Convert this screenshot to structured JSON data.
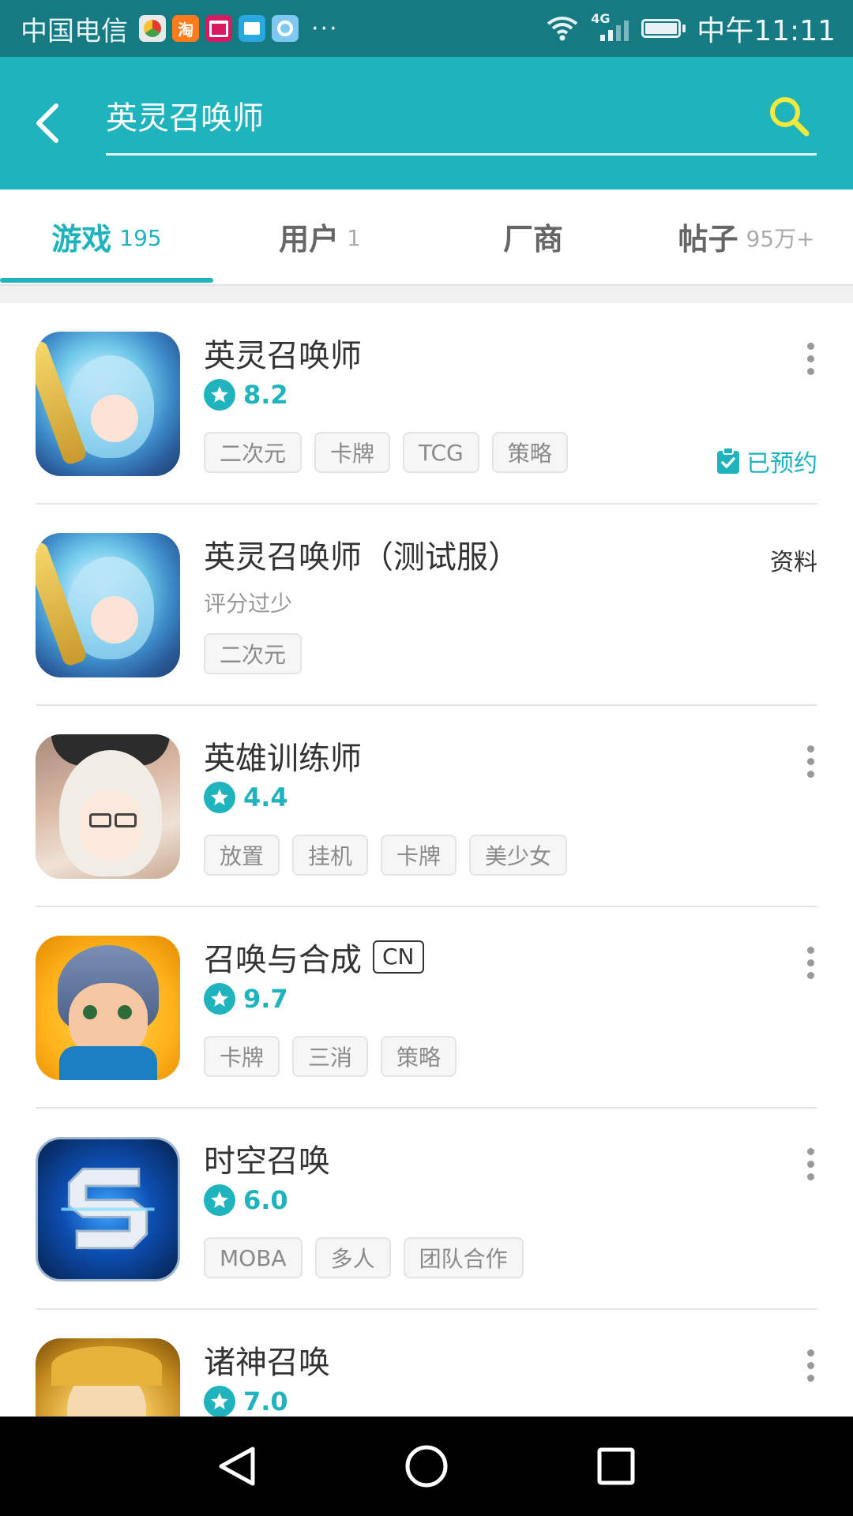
{
  "status_bar": {
    "carrier": "中国电信",
    "more": "···",
    "network": "4G",
    "time": "中午11:11"
  },
  "search": {
    "query": "英灵召唤师"
  },
  "tabs": [
    {
      "label": "游戏",
      "count": "195",
      "active": true
    },
    {
      "label": "用户",
      "count": "1",
      "active": false
    },
    {
      "label": "厂商",
      "count": "",
      "active": false
    },
    {
      "label": "帖子",
      "count": "95万+",
      "active": false
    }
  ],
  "games": [
    {
      "title": "英灵召唤师",
      "rating": "8.2",
      "tags": [
        "二次元",
        "卡牌",
        "TCG",
        "策略"
      ],
      "status": "已预约",
      "icon": "anime-girl-blue-hair-icon"
    },
    {
      "title": "英灵召唤师（测试服）",
      "rating_note": "评分过少",
      "tags": [
        "二次元"
      ],
      "action": "资料",
      "icon": "anime-girl-blue-hair-icon"
    },
    {
      "title": "英雄训练师",
      "rating": "4.4",
      "tags": [
        "放置",
        "挂机",
        "卡牌",
        "美少女"
      ],
      "icon": "anime-maid-girl-icon"
    },
    {
      "title": "召唤与合成",
      "badge": "CN",
      "rating": "9.7",
      "tags": [
        "卡牌",
        "三消",
        "策略"
      ],
      "icon": "cartoon-knight-boy-icon"
    },
    {
      "title": "时空召唤",
      "rating": "6.0",
      "tags": [
        "MOBA",
        "多人",
        "团队合作"
      ],
      "icon": "blue-s-logo-icon"
    },
    {
      "title": "诸神召唤",
      "rating": "7.0",
      "tags": [],
      "icon": "golden-goddess-icon"
    }
  ],
  "colors": {
    "accent": "#1fb3bd",
    "status_bar": "#157a82",
    "header": "#1fb3bd"
  }
}
